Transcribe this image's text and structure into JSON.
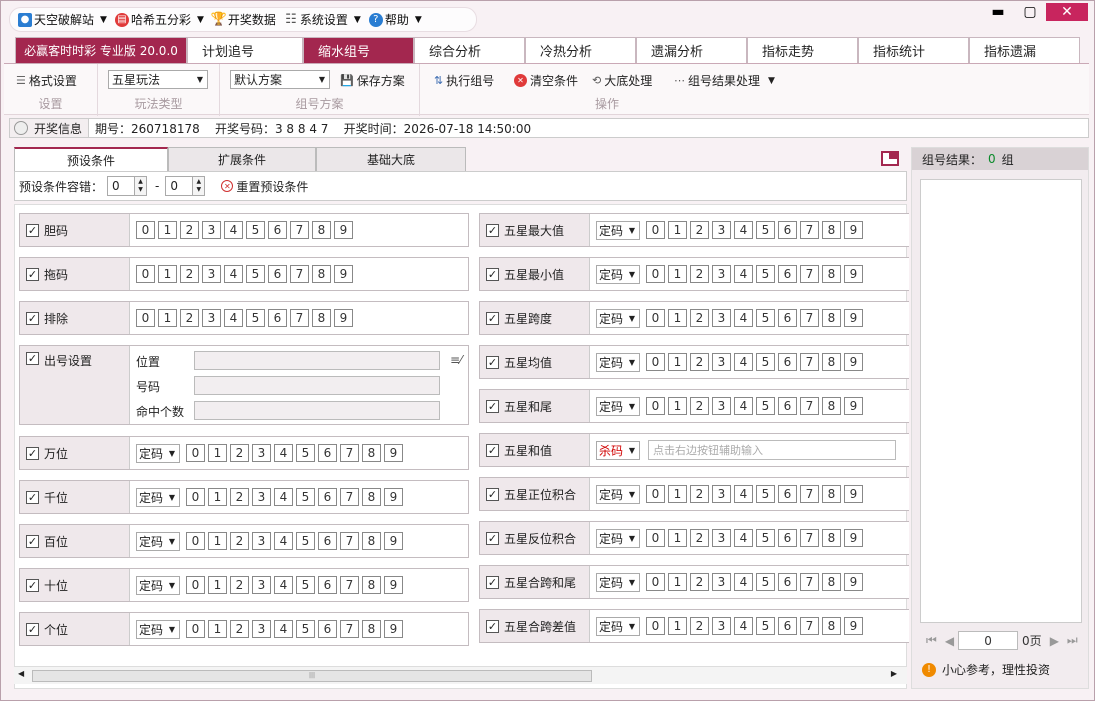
{
  "menu": [
    {
      "icon": "user-icon",
      "label": "天空破解站",
      "dropdown": true
    },
    {
      "icon": "calculator-icon",
      "label": "哈希五分彩",
      "dropdown": true
    },
    {
      "icon": "trophy-icon",
      "label": "开奖数据",
      "dropdown": false
    },
    {
      "icon": "settings-icon",
      "label": "系统设置",
      "dropdown": true
    },
    {
      "icon": "help-icon",
      "label": "帮助",
      "dropdown": true
    }
  ],
  "tabs": [
    "必赢客时时彩 专业版 20.0.0",
    "计划追号",
    "缩水组号",
    "综合分析",
    "冷热分析",
    "遗漏分析",
    "指标走势",
    "指标统计",
    "指标遗漏"
  ],
  "toolbar": {
    "format_label": "格式设置",
    "format_caption": "设置",
    "play_value": "五星玩法",
    "play_caption": "玩法类型",
    "scheme_value": "默认方案",
    "save_label": "保存方案",
    "scheme_caption": "组号方案",
    "execute_label": "执行组号",
    "clear_label": "清空条件",
    "bottom_label": "大底处理",
    "result_label": "组号结果处理",
    "ops_caption": "操作"
  },
  "info": {
    "label": "开奖信息",
    "text": "期号：260718178    开奖号码：3 8 8 4 7    开奖时间：2026-07-18 14:50:00"
  },
  "subtabs": [
    "预设条件",
    "扩展条件",
    "基础大底"
  ],
  "tolerance": {
    "label": "预设条件容错：",
    "min": "0",
    "max": "0",
    "sep": "-",
    "reset_label": "重置预设条件"
  },
  "digits": [
    "0",
    "1",
    "2",
    "3",
    "4",
    "5",
    "6",
    "7",
    "8",
    "9"
  ],
  "left_rows": {
    "dan": "胆码",
    "tuo": "拖码",
    "exclude": "排除"
  },
  "output": {
    "title": "出号设置",
    "pos": "位置",
    "code": "号码",
    "hits": "命中个数"
  },
  "pos_rows": [
    "万位",
    "千位",
    "百位",
    "十位",
    "个位"
  ],
  "pos_select": "定码",
  "right_rows": [
    "五星最大值",
    "五星最小值",
    "五星跨度",
    "五星均值",
    "五星和尾",
    "五星和值",
    "五星正位积合",
    "五星反位积合",
    "五星合跨和尾",
    "五星合跨差值"
  ],
  "sum_row": {
    "select": "杀码",
    "placeholder": "点击右边按钮辅助输入"
  },
  "result": {
    "label": "组号结果：",
    "count": "0",
    "unit": "组",
    "page_value": "0",
    "page_label": "0页",
    "tip": "小心参考，理性投资"
  },
  "colors": {
    "accent": "#a3274f",
    "count": "#0a8a2a",
    "warn": "#f08a00",
    "kill": "#d00000"
  }
}
